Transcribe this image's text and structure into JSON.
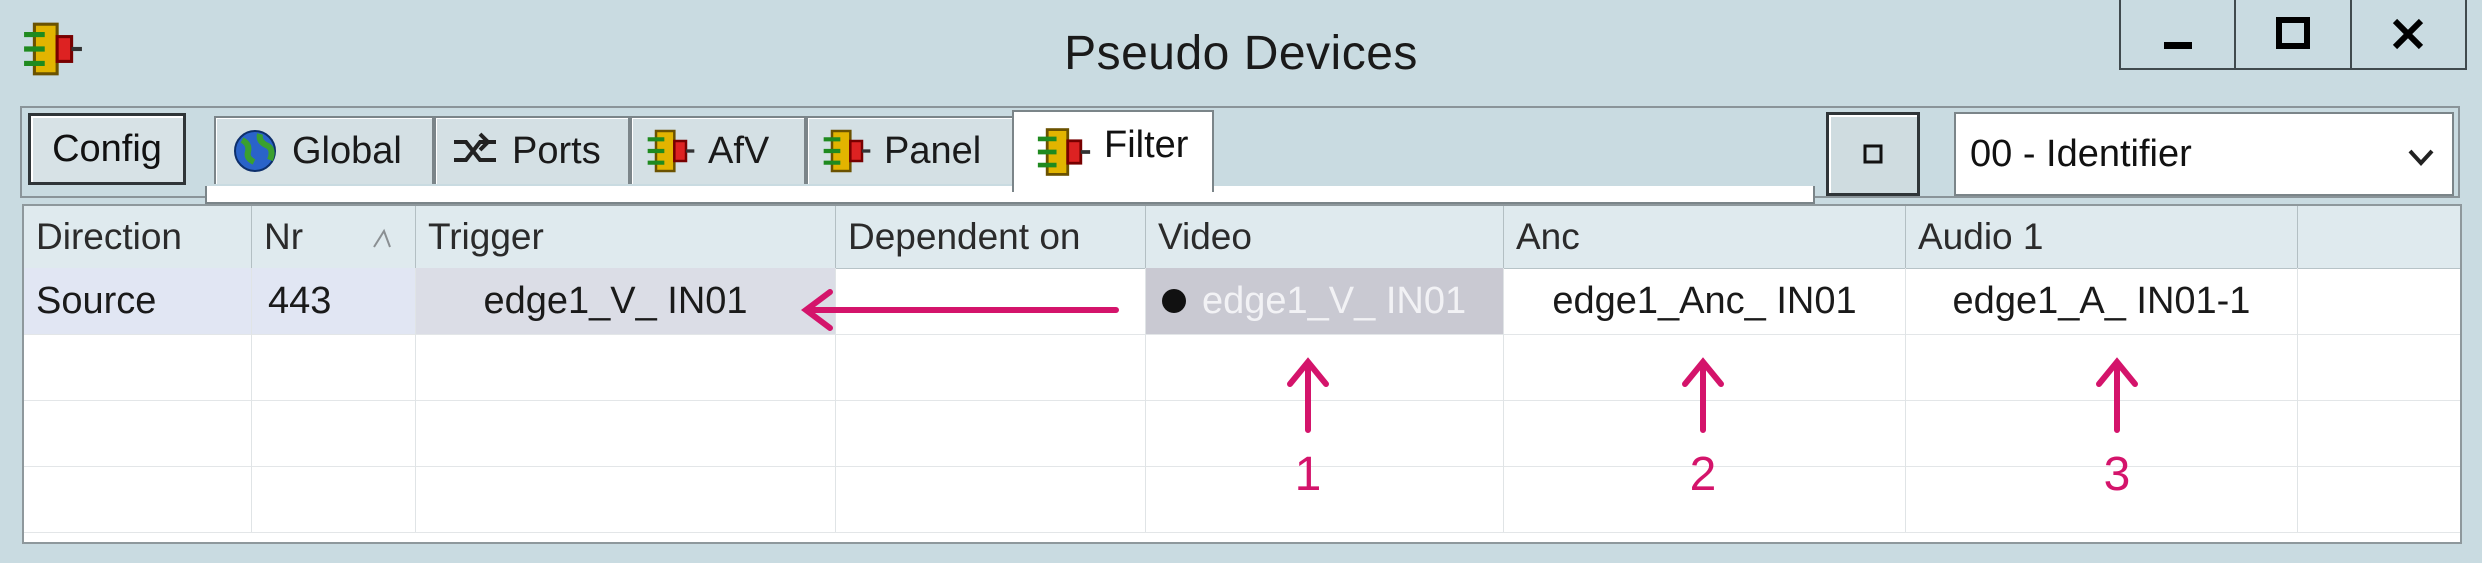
{
  "window": {
    "title": "Pseudo Devices"
  },
  "toolbar": {
    "config_label": "Config",
    "tabs": [
      {
        "label": "Global",
        "icon": "globe-icon"
      },
      {
        "label": "Ports",
        "icon": "ports-icon"
      },
      {
        "label": "AfV",
        "icon": "device-icon"
      },
      {
        "label": "Panel",
        "icon": "device-icon"
      },
      {
        "label": "Filter",
        "icon": "device-icon",
        "active": true
      }
    ],
    "identifier_select": "00 - Identifier"
  },
  "grid": {
    "columns": [
      "Direction",
      "Nr",
      "Trigger",
      "Dependent on",
      "Video",
      "Anc",
      "Audio 1"
    ],
    "rows": [
      {
        "direction": "Source",
        "nr": "443",
        "trigger": "edge1_V_ IN01",
        "dependent_on": "",
        "video": "edge1_V_ IN01",
        "anc": "edge1_Anc_ IN01",
        "audio1": "edge1_A_ IN01-1"
      }
    ]
  },
  "annotations": {
    "markers": [
      "1",
      "2",
      "3"
    ],
    "color": "#d4146b"
  },
  "colors": {
    "background": "#c9dbe1",
    "selected_row": "#e1e6f3",
    "video_cell": "#c9c9d2"
  }
}
